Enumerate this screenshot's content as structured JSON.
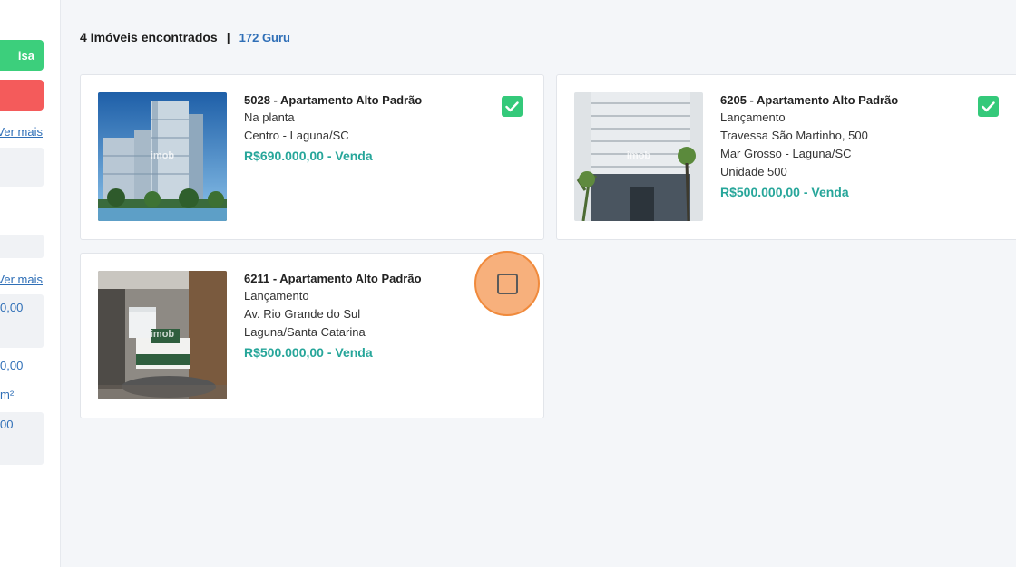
{
  "sidebar": {
    "search_button": "isa",
    "ver_mais_1": "Ver mais",
    "ver_mais_2": "Ver mais",
    "value_1": "0,00",
    "value_2": "0,00",
    "value_3": "m²",
    "value_4": "00"
  },
  "header": {
    "count": "4 Imóveis encontrados",
    "separator": "|",
    "link": "172 Guru"
  },
  "listings": [
    {
      "title": "5028 - Apartamento Alto Padrão",
      "lines": [
        "Na planta",
        "Centro - Laguna/SC"
      ],
      "price": "R$690.000,00 - Venda",
      "selected": true,
      "watermark": "imob"
    },
    {
      "title": "6205 - Apartamento Alto Padrão",
      "lines": [
        "Lançamento",
        "Travessa São Martinho, 500",
        "Mar Grosso - Laguna/SC",
        "Unidade 500"
      ],
      "price": "R$500.000,00 - Venda",
      "selected": true,
      "watermark": "imob"
    },
    {
      "title": "6211 - Apartamento Alto Padrão",
      "lines": [
        "Lançamento",
        "Av. Rio Grande do Sul",
        "Laguna/Santa Catarina"
      ],
      "price": "R$500.000,00 - Venda",
      "selected": false,
      "watermark": "imob"
    }
  ],
  "colors": {
    "accent_green": "#34c97a",
    "price_teal": "#27a69a",
    "link_blue": "#2f6fb7",
    "danger_red": "#f45b5b",
    "highlight_orange": "#f08a3c"
  },
  "icons": {
    "checked": "check-icon",
    "unchecked": "empty-checkbox-icon"
  }
}
